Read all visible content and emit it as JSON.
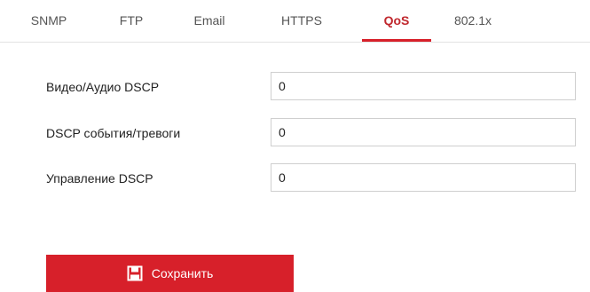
{
  "tabs": [
    {
      "label": "SNMP",
      "active": false
    },
    {
      "label": "FTP",
      "active": false
    },
    {
      "label": "Email",
      "active": false
    },
    {
      "label": "HTTPS",
      "active": false
    },
    {
      "label": "QoS",
      "active": true
    },
    {
      "label": "802.1x",
      "active": false
    }
  ],
  "fields": [
    {
      "label": "Видео/Аудио DSCP",
      "value": "0"
    },
    {
      "label": "DSCP события/тревоги",
      "value": "0"
    },
    {
      "label": "Управление DSCP",
      "value": "0"
    }
  ],
  "save_button": {
    "label": "Сохранить",
    "icon": "floppy-disk-icon"
  },
  "colors": {
    "accent": "#d7202a",
    "active_tab_text": "#c0272d"
  }
}
